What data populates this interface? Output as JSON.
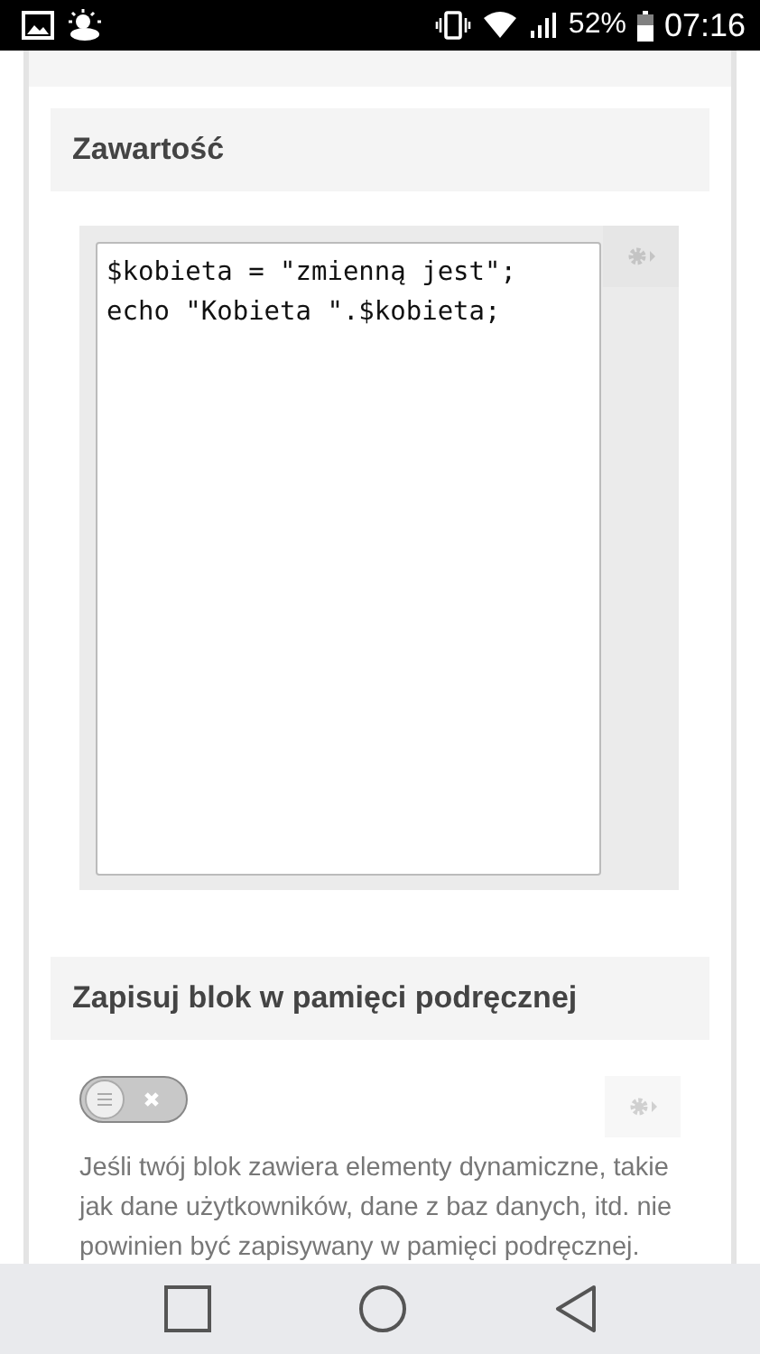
{
  "status_bar": {
    "battery": "52%",
    "time": "07:16"
  },
  "content_section": {
    "title": "Zawartość",
    "code_lines": [
      "$kobieta = \"zmienną jest\";",
      "echo \"Kobieta \".$kobieta;"
    ]
  },
  "cache_section": {
    "title": "Zapisuj blok w pamięci podręcznej",
    "toggle": {
      "checked": false
    },
    "description": "Jeśli twój blok zawiera elementy dynamiczne, takie jak dane użytkowników, dane z baz danych, itd. nie powinien być zapisywany w pamięci podręcznej."
  }
}
